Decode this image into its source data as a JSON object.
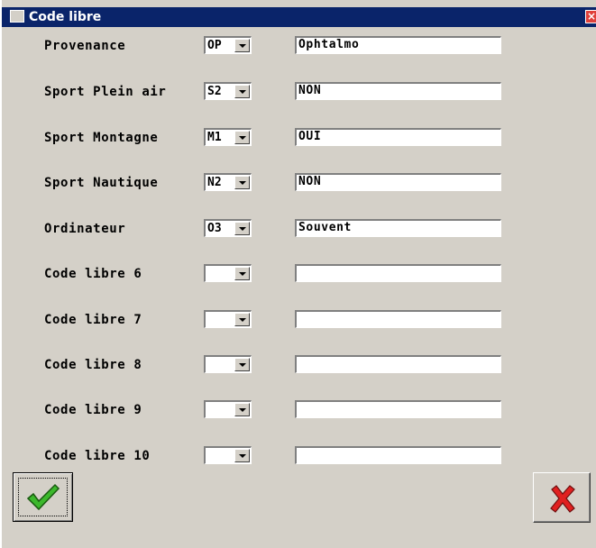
{
  "window": {
    "title": "Code libre",
    "close_glyph": "×"
  },
  "rows": [
    {
      "label": "Provenance",
      "code": "OP",
      "value": "Ophtalmo"
    },
    {
      "label": "Sport Plein air",
      "code": "S2",
      "value": "NON"
    },
    {
      "label": "Sport Montagne",
      "code": "M1",
      "value": "OUI"
    },
    {
      "label": "Sport Nautique",
      "code": "N2",
      "value": "NON"
    },
    {
      "label": "Ordinateur",
      "code": "O3",
      "value": "Souvent"
    },
    {
      "label": "Code libre 6",
      "code": "",
      "value": ""
    },
    {
      "label": "Code libre 7",
      "code": "",
      "value": ""
    },
    {
      "label": "Code libre 8",
      "code": "",
      "value": ""
    },
    {
      "label": "Code libre 9",
      "code": "",
      "value": ""
    },
    {
      "label": "Code libre 10",
      "code": "",
      "value": ""
    }
  ],
  "buttons": {
    "ok_icon": "green-checkmark-icon",
    "cancel_icon": "red-x-icon"
  },
  "colors": {
    "titlebar": "#0a246a",
    "check": "#3cb82c",
    "cross": "#e02020"
  }
}
